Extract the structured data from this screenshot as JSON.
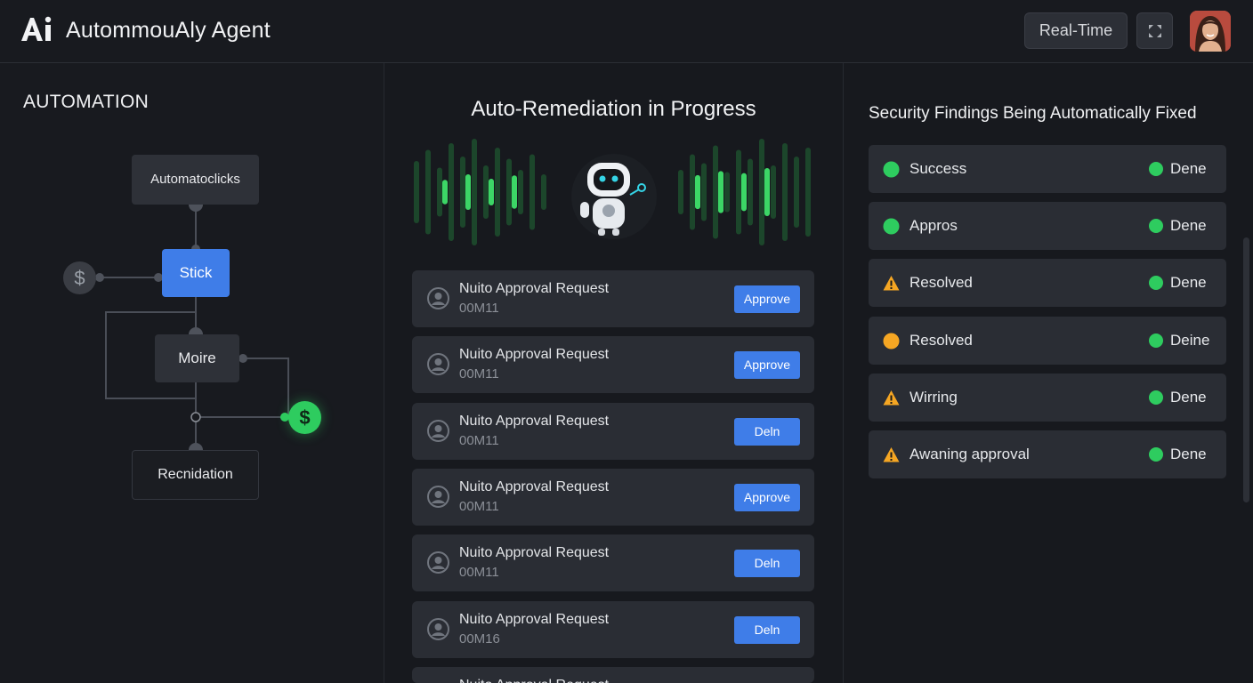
{
  "header": {
    "logo_text": "Ai",
    "title": "AutommouAly Agent",
    "realtime_label": "Real-Time",
    "expand_icon": "expand-icon"
  },
  "left": {
    "section_label": "AUTOMATION",
    "nodes": {
      "auto": "Automatoclicks",
      "stick": "Stick",
      "moire": "Moire",
      "recn": "Recnidation"
    },
    "dollar_symbol": "$"
  },
  "middle": {
    "title": "Auto-Remediation in Progress",
    "requests": [
      {
        "title": "Nuito Approval Request",
        "id": "00M11",
        "action": "Approve"
      },
      {
        "title": "Nuito Approval Request",
        "id": "00M11",
        "action": "Approve"
      },
      {
        "title": "Nuito Approval Request",
        "id": "00M11",
        "action": "Deln"
      },
      {
        "title": "Nuito Approval Request",
        "id": "00M11",
        "action": "Approve"
      },
      {
        "title": "Nuito Approval Request",
        "id": "00M11",
        "action": "Deln"
      },
      {
        "title": "Nuito Approval Request",
        "id": "00M16",
        "action": "Deln"
      }
    ],
    "partial_row_title": "Nuito Approval Request"
  },
  "right": {
    "title": "Security Findings Being Automatically Fixed",
    "findings": [
      {
        "icon": "green-dot-icon",
        "label": "Success",
        "status": "Dene"
      },
      {
        "icon": "green-dot-icon",
        "label": "Appros",
        "status": "Dene"
      },
      {
        "icon": "warning-icon",
        "label": "Resolved",
        "status": "Dene"
      },
      {
        "icon": "orange-dot-icon",
        "label": "Resolved",
        "status": "Deine"
      },
      {
        "icon": "warning-icon",
        "label": "Wirring",
        "status": "Dene"
      },
      {
        "icon": "warning-icon",
        "label": "Awaning approval",
        "status": "Dene"
      }
    ]
  },
  "colors": {
    "accent_blue": "#3f7de8",
    "success_green": "#2ecc5f",
    "warning_orange": "#f5a623",
    "background": "#16181d"
  }
}
